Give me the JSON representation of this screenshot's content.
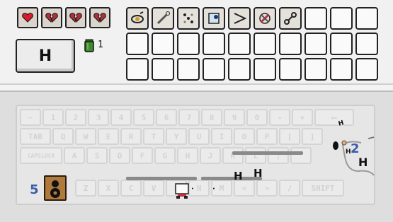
{
  "hud": {
    "hearts": [
      "full",
      "broken",
      "broken",
      "broken"
    ],
    "active_key_label": "H",
    "jar_count": "1"
  },
  "inventory": {
    "filled": [
      "eye-orb-icon",
      "wand-icon",
      "dice-dots-icon",
      "crystal-icon",
      "beak-icon",
      "cross-gem-icon",
      "chain-icon"
    ],
    "total_slots": 30
  },
  "keyboard": {
    "row1": [
      "~",
      "1",
      "2",
      "3",
      "4",
      "5",
      "6",
      "7",
      "8",
      "9",
      "0",
      "-",
      "+",
      "⟵"
    ],
    "row2": [
      "TAB",
      "Q",
      "W",
      "E",
      "R",
      "T",
      "Y",
      "U",
      "I",
      "O",
      "P",
      "[",
      "]"
    ],
    "row3": [
      "CAPSLOCK",
      "A",
      "S",
      "D",
      "F",
      "G",
      "H",
      "J",
      "K",
      "L",
      ";",
      "'"
    ],
    "row4": [
      "Z",
      "X",
      "C",
      "V",
      "B",
      "N",
      "M",
      "<",
      ">",
      "/",
      "SHIFT"
    ]
  },
  "scene": {
    "letters": [
      "H",
      "H",
      "H",
      "H",
      "H"
    ],
    "enemy_count": "5",
    "boss_count": "2"
  },
  "colors": {
    "heart_full": "#d81c2c",
    "heart_broken": "#b0303a",
    "accent_blue": "#3a5ea8"
  }
}
